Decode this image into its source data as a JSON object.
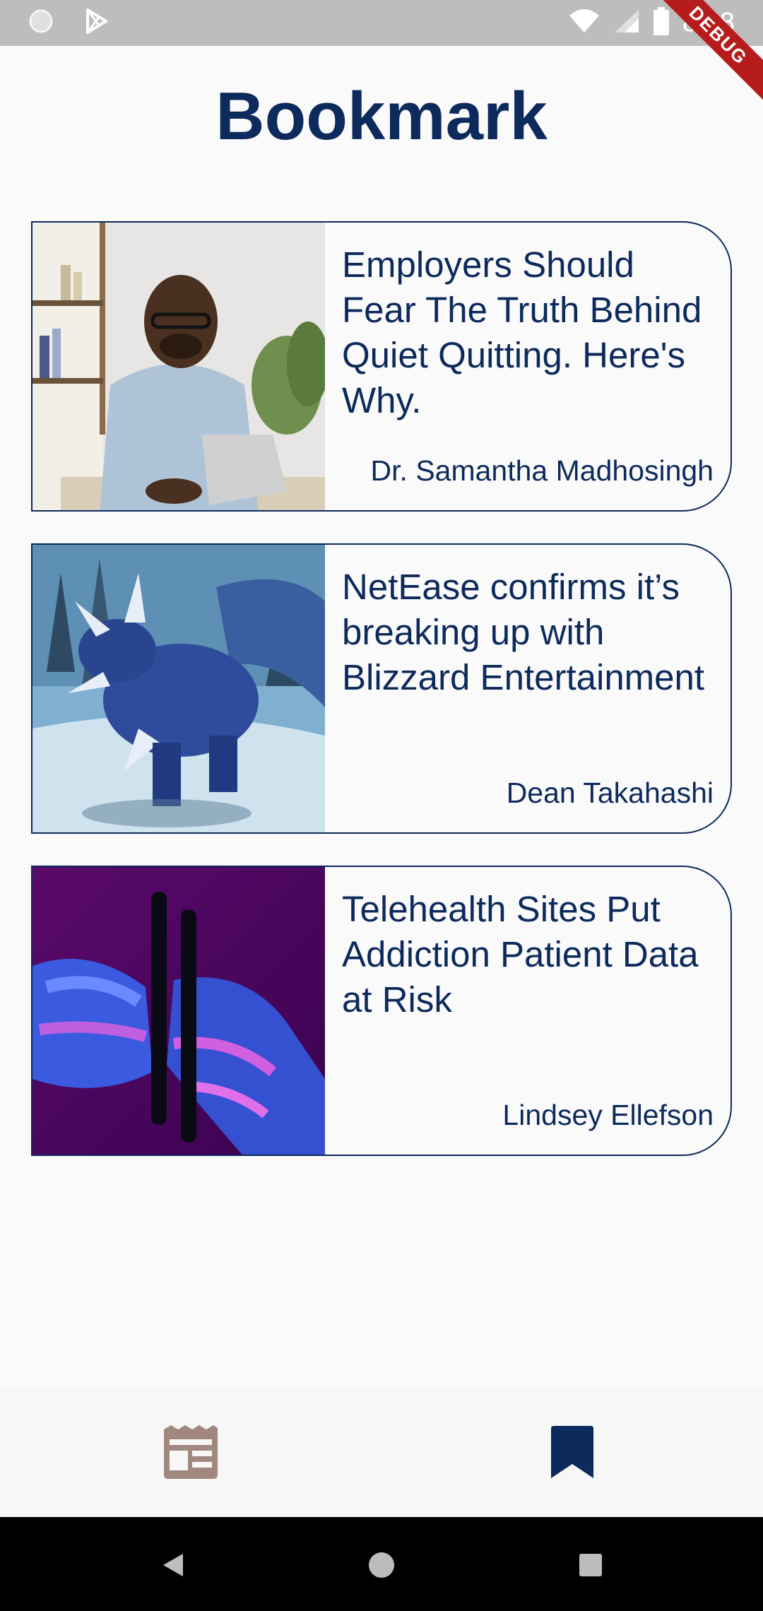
{
  "status_bar": {
    "time": "8:38",
    "debug_label": "DEBUG"
  },
  "page": {
    "title": "Bookmark"
  },
  "bookmarks": [
    {
      "title": "Employers Should Fear The Truth Behind Quiet Quitting. Here's Why.",
      "author": "Dr. Samantha Madhosingh",
      "image": "man-at-laptop-photo"
    },
    {
      "title": "NetEase confirms it’s breaking up with Blizzard Entertainment",
      "author": "Dean Takahashi",
      "image": "blue-dragon-game-art"
    },
    {
      "title": "Telehealth Sites Put Addiction Patient Data at Risk",
      "author": "Lindsey Ellefson",
      "image": "hands-holding-phone-photo"
    }
  ],
  "bottom_nav": {
    "items": [
      {
        "icon": "newspaper-icon",
        "active": false,
        "color": "#a1887f"
      },
      {
        "icon": "bookmark-icon",
        "active": true,
        "color": "#0d2a5c"
      }
    ]
  },
  "colors": {
    "primary": "#0d2a5c",
    "background": "#fafafa",
    "debug_banner": "#b71c1c"
  }
}
